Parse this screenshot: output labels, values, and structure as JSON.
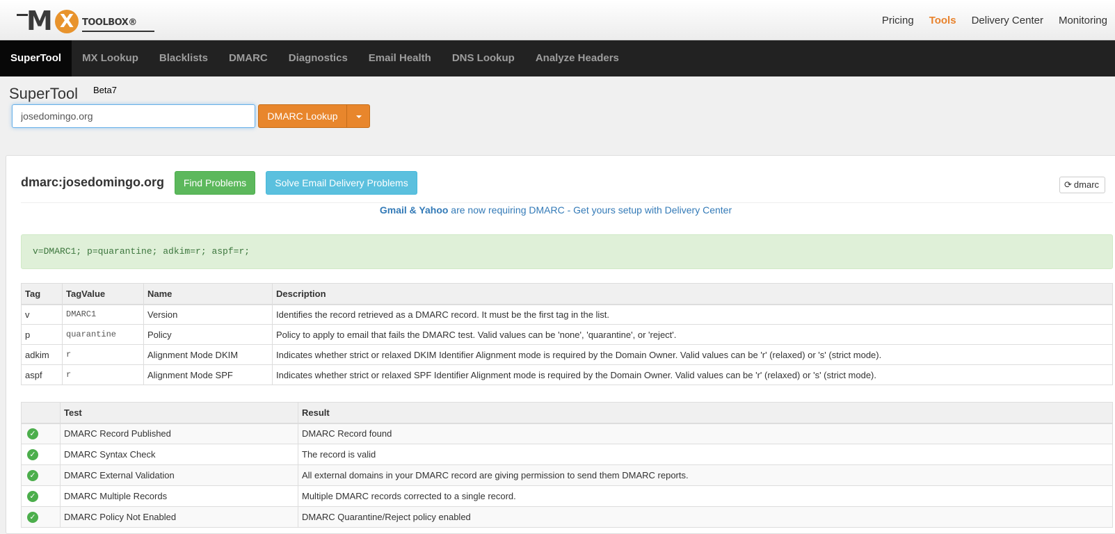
{
  "header": {
    "logo_text": "MX TOOLBOX",
    "nav": [
      "Pricing",
      "Tools",
      "Delivery Center",
      "Monitoring"
    ],
    "active_nav": "Tools"
  },
  "main_nav": {
    "items": [
      "SuperTool",
      "MX Lookup",
      "Blacklists",
      "DMARC",
      "Diagnostics",
      "Email Health",
      "DNS Lookup",
      "Analyze Headers"
    ],
    "active": "SuperTool"
  },
  "supertool": {
    "title": "SuperTool",
    "version": "Beta7",
    "query_value": "josedomingo.org",
    "lookup_button": "DMARC Lookup"
  },
  "result": {
    "title": "dmarc:josedomingo.org",
    "find_problems": "Find Problems",
    "solve_problems": "Solve Email Delivery Problems",
    "refresh_label": "dmarc",
    "promo_bold": "Gmail & Yahoo",
    "promo_text": " are now requiring DMARC - Get yours setup with Delivery Center",
    "record": "v=DMARC1; p=quarantine; adkim=r; aspf=r;"
  },
  "tag_table": {
    "headers": [
      "Tag",
      "TagValue",
      "Name",
      "Description"
    ],
    "rows": [
      {
        "tag": "v",
        "value": "DMARC1",
        "name": "Version",
        "description": "Identifies the record retrieved as a DMARC record. It must be the first tag in the list."
      },
      {
        "tag": "p",
        "value": "quarantine",
        "name": "Policy",
        "description": "Policy to apply to email that fails the DMARC test. Valid values can be 'none', 'quarantine', or 'reject'."
      },
      {
        "tag": "adkim",
        "value": "r",
        "name": "Alignment Mode DKIM",
        "description": "Indicates whether strict or relaxed DKIM Identifier Alignment mode is required by the Domain Owner. Valid values can be 'r' (relaxed) or 's' (strict mode)."
      },
      {
        "tag": "aspf",
        "value": "r",
        "name": "Alignment Mode SPF",
        "description": "Indicates whether strict or relaxed SPF Identifier Alignment mode is required by the Domain Owner. Valid values can be 'r' (relaxed) or 's' (strict mode)."
      }
    ]
  },
  "test_table": {
    "headers": [
      "",
      "Test",
      "Result"
    ],
    "rows": [
      {
        "status": "ok",
        "test": "DMARC Record Published",
        "result": "DMARC Record found"
      },
      {
        "status": "ok",
        "test": "DMARC Syntax Check",
        "result": "The record is valid"
      },
      {
        "status": "ok",
        "test": "DMARC External Validation",
        "result": "All external domains in your DMARC record are giving permission to send them DMARC reports."
      },
      {
        "status": "ok",
        "test": "DMARC Multiple Records",
        "result": "Multiple DMARC records corrected to a single record."
      },
      {
        "status": "ok",
        "test": "DMARC Policy Not Enabled",
        "result": "DMARC Quarantine/Reject policy enabled"
      }
    ]
  },
  "icons": {
    "status_ok": "check-circle-icon",
    "refresh": "refresh-icon",
    "caret": "caret-down-icon"
  },
  "colors": {
    "accent_orange": "#e8862c",
    "success_green": "#5cb85c",
    "info_blue": "#5bc0de",
    "nav_dark": "#222222"
  }
}
